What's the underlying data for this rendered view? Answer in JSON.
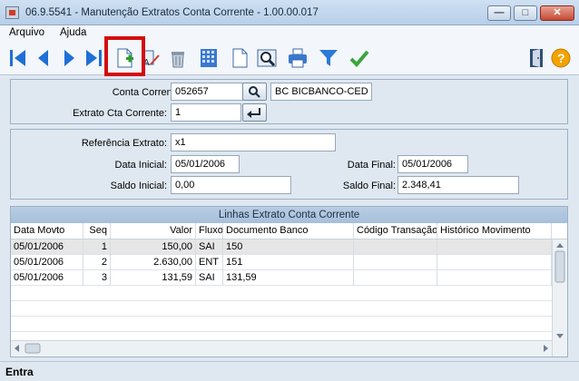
{
  "window": {
    "title": "06.9.5541 - Manutenção Extratos Conta Corrente - 1.00.00.017",
    "min_glyph": "—",
    "max_glyph": "□",
    "close_glyph": "✕"
  },
  "menu": {
    "items": [
      {
        "label": "Arquivo"
      },
      {
        "label": "Ajuda"
      }
    ]
  },
  "toolbar": {
    "icons": [
      "first-icon",
      "previous-icon",
      "next-icon",
      "last-icon",
      "new-record-icon",
      "edit-icon",
      "delete-icon",
      "calculator-icon",
      "document-icon",
      "zoom-icon",
      "print-icon",
      "filter-icon",
      "confirm-icon",
      "exit-door-icon",
      "help-icon"
    ],
    "help_label": "?"
  },
  "header_form": {
    "conta_corrente_label": "Conta Corrente:",
    "conta_corrente_value": "052657",
    "conta_corrente_desc": "BC BICBANCO-CED",
    "extrato_label": "Extrato Cta Corrente:",
    "extrato_value": "1"
  },
  "detail_form": {
    "referencia_label": "Referência Extrato:",
    "referencia_value": "x1",
    "data_inicial_label": "Data Inicial:",
    "data_inicial_value": "05/01/2006",
    "data_final_label": "Data Final:",
    "data_final_value": "05/01/2006",
    "saldo_inicial_label": "Saldo Inicial:",
    "saldo_inicial_value": "0,00",
    "saldo_final_label": "Saldo Final:",
    "saldo_final_value": "2.348,41"
  },
  "grid": {
    "caption": "Linhas Extrato Conta Corrente",
    "columns": [
      "Data Movto",
      "Seq",
      "Valor",
      "Fluxo",
      "Documento Banco",
      "Código Transação",
      "Histórico Movimento"
    ],
    "rows": [
      [
        "05/01/2006",
        "1",
        "150,00",
        "SAI",
        "150",
        "",
        ""
      ],
      [
        "05/01/2006",
        "2",
        "2.630,00",
        "ENT",
        "151",
        "",
        ""
      ],
      [
        "05/01/2006",
        "3",
        "131,59",
        "SAI",
        "131,59",
        "",
        ""
      ]
    ]
  },
  "status": {
    "text": "Entra"
  },
  "colors": {
    "highlight": "#d40c0c",
    "accent_blue": "#1f6fd6"
  }
}
